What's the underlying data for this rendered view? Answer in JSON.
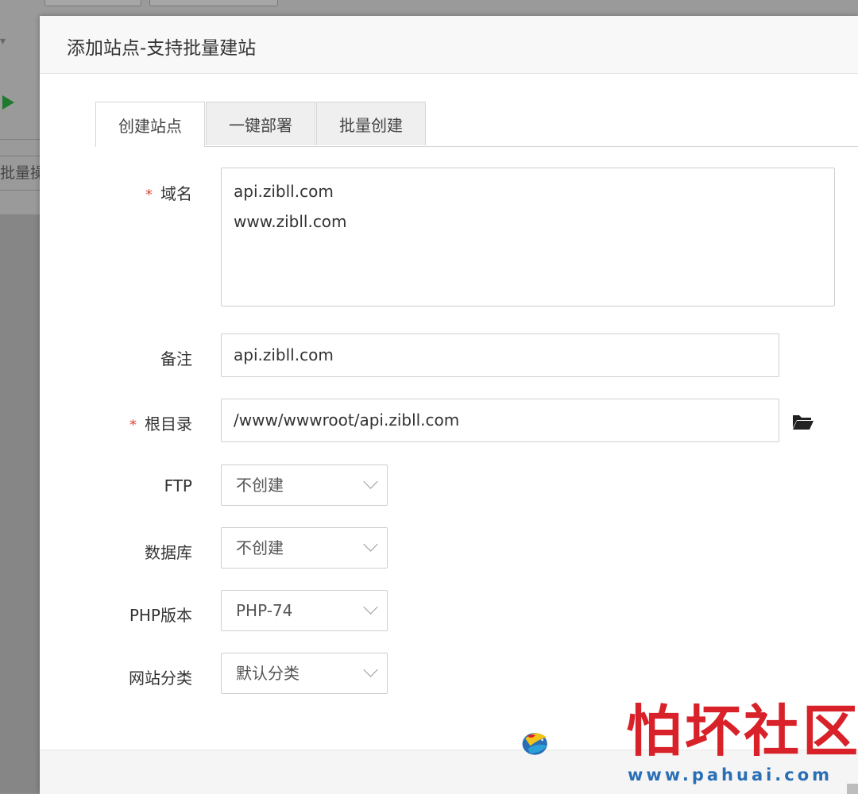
{
  "background": {
    "batch_label": "批量操作"
  },
  "modal": {
    "title": "添加站点-支持批量建站"
  },
  "tabs": [
    {
      "label": "创建站点"
    },
    {
      "label": "一键部署"
    },
    {
      "label": "批量创建"
    }
  ],
  "form": {
    "domain": {
      "label": "域名",
      "required_mark": "*",
      "lines": [
        "api.zibll.com",
        "www.zibll.com"
      ]
    },
    "remark": {
      "label": "备注",
      "value": "api.zibll.com"
    },
    "root": {
      "label": "根目录",
      "required_mark": "*",
      "value": "/www/wwwroot/api.zibll.com"
    },
    "ftp": {
      "label": "FTP",
      "selected": "不创建"
    },
    "database": {
      "label": "数据库",
      "selected": "不创建"
    },
    "php": {
      "label": "PHP版本",
      "selected": "PHP-74"
    },
    "category": {
      "label": "网站分类",
      "selected": "默认分类"
    }
  },
  "watermark": {
    "name": "怕坏社区",
    "url": "www.pahuai.com"
  },
  "colors": {
    "required": "#e0443a",
    "watermark_red": "#d82128",
    "watermark_blue": "#2a6fb6",
    "play_green": "#1f7a2e"
  },
  "icons": {
    "folder": "folder-open-icon",
    "dropdown": "chevron-down-icon",
    "play": "play-icon"
  }
}
